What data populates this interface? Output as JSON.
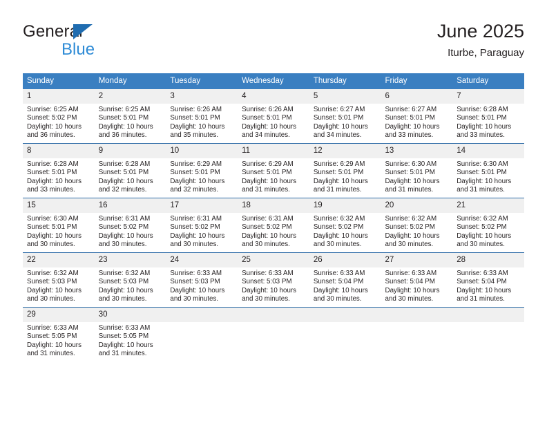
{
  "brand": {
    "name_dark": "General",
    "name_blue": "Blue",
    "triangle_color": "#1f6cb0",
    "blue_color": "#2e8bd6"
  },
  "header": {
    "title": "June 2025",
    "subtitle": "Iturbe, Paraguay"
  },
  "theme": {
    "header_blue": "#3a7fc1",
    "row_rule": "#2f6da8",
    "daynum_bg": "#f0f0f0",
    "text": "#231f20"
  },
  "calendar": {
    "weekday_headers": [
      "Sunday",
      "Monday",
      "Tuesday",
      "Wednesday",
      "Thursday",
      "Friday",
      "Saturday"
    ],
    "weeks": [
      [
        {
          "day": "1",
          "sunrise": "Sunrise: 6:25 AM",
          "sunset": "Sunset: 5:02 PM",
          "daylight1": "Daylight: 10 hours",
          "daylight2": "and 36 minutes."
        },
        {
          "day": "2",
          "sunrise": "Sunrise: 6:25 AM",
          "sunset": "Sunset: 5:01 PM",
          "daylight1": "Daylight: 10 hours",
          "daylight2": "and 36 minutes."
        },
        {
          "day": "3",
          "sunrise": "Sunrise: 6:26 AM",
          "sunset": "Sunset: 5:01 PM",
          "daylight1": "Daylight: 10 hours",
          "daylight2": "and 35 minutes."
        },
        {
          "day": "4",
          "sunrise": "Sunrise: 6:26 AM",
          "sunset": "Sunset: 5:01 PM",
          "daylight1": "Daylight: 10 hours",
          "daylight2": "and 34 minutes."
        },
        {
          "day": "5",
          "sunrise": "Sunrise: 6:27 AM",
          "sunset": "Sunset: 5:01 PM",
          "daylight1": "Daylight: 10 hours",
          "daylight2": "and 34 minutes."
        },
        {
          "day": "6",
          "sunrise": "Sunrise: 6:27 AM",
          "sunset": "Sunset: 5:01 PM",
          "daylight1": "Daylight: 10 hours",
          "daylight2": "and 33 minutes."
        },
        {
          "day": "7",
          "sunrise": "Sunrise: 6:28 AM",
          "sunset": "Sunset: 5:01 PM",
          "daylight1": "Daylight: 10 hours",
          "daylight2": "and 33 minutes."
        }
      ],
      [
        {
          "day": "8",
          "sunrise": "Sunrise: 6:28 AM",
          "sunset": "Sunset: 5:01 PM",
          "daylight1": "Daylight: 10 hours",
          "daylight2": "and 33 minutes."
        },
        {
          "day": "9",
          "sunrise": "Sunrise: 6:28 AM",
          "sunset": "Sunset: 5:01 PM",
          "daylight1": "Daylight: 10 hours",
          "daylight2": "and 32 minutes."
        },
        {
          "day": "10",
          "sunrise": "Sunrise: 6:29 AM",
          "sunset": "Sunset: 5:01 PM",
          "daylight1": "Daylight: 10 hours",
          "daylight2": "and 32 minutes."
        },
        {
          "day": "11",
          "sunrise": "Sunrise: 6:29 AM",
          "sunset": "Sunset: 5:01 PM",
          "daylight1": "Daylight: 10 hours",
          "daylight2": "and 31 minutes."
        },
        {
          "day": "12",
          "sunrise": "Sunrise: 6:29 AM",
          "sunset": "Sunset: 5:01 PM",
          "daylight1": "Daylight: 10 hours",
          "daylight2": "and 31 minutes."
        },
        {
          "day": "13",
          "sunrise": "Sunrise: 6:30 AM",
          "sunset": "Sunset: 5:01 PM",
          "daylight1": "Daylight: 10 hours",
          "daylight2": "and 31 minutes."
        },
        {
          "day": "14",
          "sunrise": "Sunrise: 6:30 AM",
          "sunset": "Sunset: 5:01 PM",
          "daylight1": "Daylight: 10 hours",
          "daylight2": "and 31 minutes."
        }
      ],
      [
        {
          "day": "15",
          "sunrise": "Sunrise: 6:30 AM",
          "sunset": "Sunset: 5:01 PM",
          "daylight1": "Daylight: 10 hours",
          "daylight2": "and 30 minutes."
        },
        {
          "day": "16",
          "sunrise": "Sunrise: 6:31 AM",
          "sunset": "Sunset: 5:02 PM",
          "daylight1": "Daylight: 10 hours",
          "daylight2": "and 30 minutes."
        },
        {
          "day": "17",
          "sunrise": "Sunrise: 6:31 AM",
          "sunset": "Sunset: 5:02 PM",
          "daylight1": "Daylight: 10 hours",
          "daylight2": "and 30 minutes."
        },
        {
          "day": "18",
          "sunrise": "Sunrise: 6:31 AM",
          "sunset": "Sunset: 5:02 PM",
          "daylight1": "Daylight: 10 hours",
          "daylight2": "and 30 minutes."
        },
        {
          "day": "19",
          "sunrise": "Sunrise: 6:32 AM",
          "sunset": "Sunset: 5:02 PM",
          "daylight1": "Daylight: 10 hours",
          "daylight2": "and 30 minutes."
        },
        {
          "day": "20",
          "sunrise": "Sunrise: 6:32 AM",
          "sunset": "Sunset: 5:02 PM",
          "daylight1": "Daylight: 10 hours",
          "daylight2": "and 30 minutes."
        },
        {
          "day": "21",
          "sunrise": "Sunrise: 6:32 AM",
          "sunset": "Sunset: 5:02 PM",
          "daylight1": "Daylight: 10 hours",
          "daylight2": "and 30 minutes."
        }
      ],
      [
        {
          "day": "22",
          "sunrise": "Sunrise: 6:32 AM",
          "sunset": "Sunset: 5:03 PM",
          "daylight1": "Daylight: 10 hours",
          "daylight2": "and 30 minutes."
        },
        {
          "day": "23",
          "sunrise": "Sunrise: 6:32 AM",
          "sunset": "Sunset: 5:03 PM",
          "daylight1": "Daylight: 10 hours",
          "daylight2": "and 30 minutes."
        },
        {
          "day": "24",
          "sunrise": "Sunrise: 6:33 AM",
          "sunset": "Sunset: 5:03 PM",
          "daylight1": "Daylight: 10 hours",
          "daylight2": "and 30 minutes."
        },
        {
          "day": "25",
          "sunrise": "Sunrise: 6:33 AM",
          "sunset": "Sunset: 5:03 PM",
          "daylight1": "Daylight: 10 hours",
          "daylight2": "and 30 minutes."
        },
        {
          "day": "26",
          "sunrise": "Sunrise: 6:33 AM",
          "sunset": "Sunset: 5:04 PM",
          "daylight1": "Daylight: 10 hours",
          "daylight2": "and 30 minutes."
        },
        {
          "day": "27",
          "sunrise": "Sunrise: 6:33 AM",
          "sunset": "Sunset: 5:04 PM",
          "daylight1": "Daylight: 10 hours",
          "daylight2": "and 30 minutes."
        },
        {
          "day": "28",
          "sunrise": "Sunrise: 6:33 AM",
          "sunset": "Sunset: 5:04 PM",
          "daylight1": "Daylight: 10 hours",
          "daylight2": "and 31 minutes."
        }
      ],
      [
        {
          "day": "29",
          "sunrise": "Sunrise: 6:33 AM",
          "sunset": "Sunset: 5:05 PM",
          "daylight1": "Daylight: 10 hours",
          "daylight2": "and 31 minutes."
        },
        {
          "day": "30",
          "sunrise": "Sunrise: 6:33 AM",
          "sunset": "Sunset: 5:05 PM",
          "daylight1": "Daylight: 10 hours",
          "daylight2": "and 31 minutes."
        },
        {
          "day": "",
          "sunrise": "",
          "sunset": "",
          "daylight1": "",
          "daylight2": ""
        },
        {
          "day": "",
          "sunrise": "",
          "sunset": "",
          "daylight1": "",
          "daylight2": ""
        },
        {
          "day": "",
          "sunrise": "",
          "sunset": "",
          "daylight1": "",
          "daylight2": ""
        },
        {
          "day": "",
          "sunrise": "",
          "sunset": "",
          "daylight1": "",
          "daylight2": ""
        },
        {
          "day": "",
          "sunrise": "",
          "sunset": "",
          "daylight1": "",
          "daylight2": ""
        }
      ]
    ]
  }
}
